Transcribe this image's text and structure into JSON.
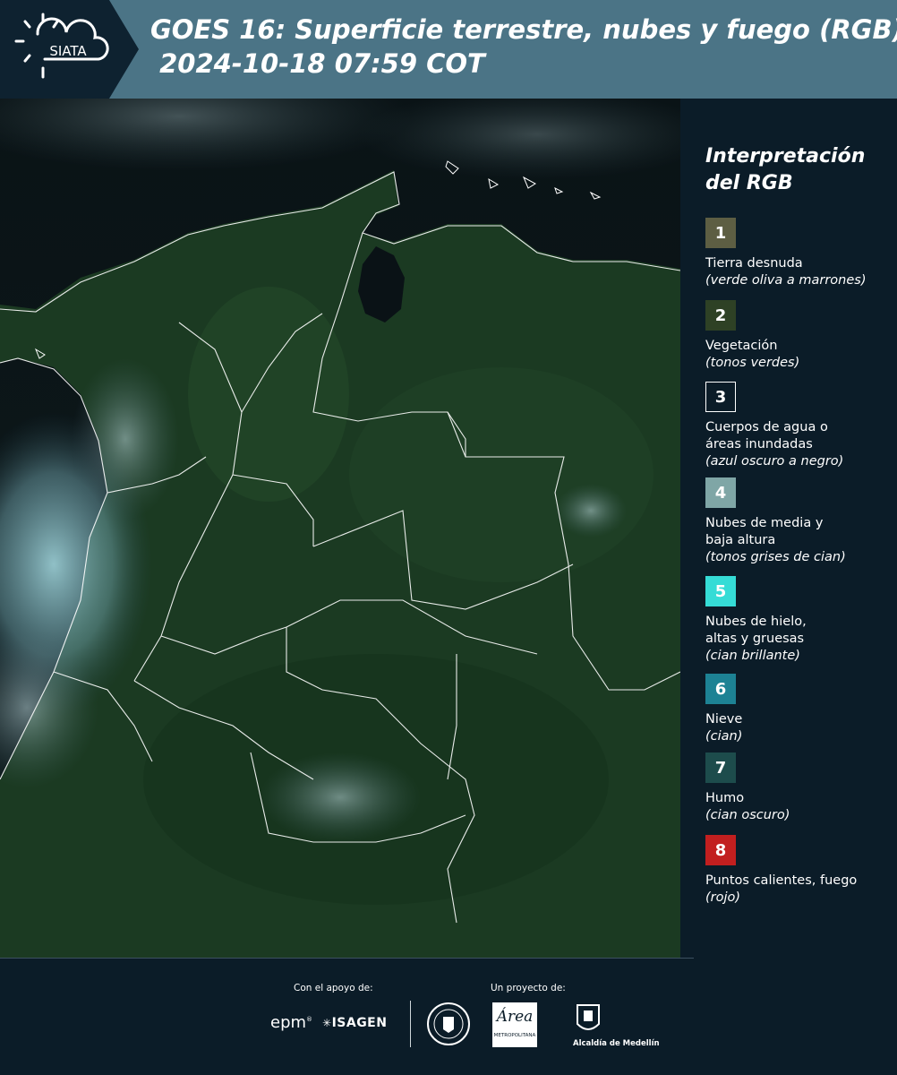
{
  "header": {
    "brand": "SIATA",
    "title_line1": "GOES 16: Superficie terrestre, nubes y fuego (RGB)",
    "title_line2": " 2024-10-18 07:59 COT"
  },
  "map": {
    "icon": "satellite-map",
    "colors": {
      "vegetation": "#1c3a22",
      "ocean": "#070d10",
      "cloud": "#8fc7d0",
      "border": "#ffffff"
    }
  },
  "legend": {
    "title": "Interpretación\ndel RGB",
    "items": [
      {
        "num": "1",
        "label": "Tierra desnuda",
        "desc": "(verde oliva a marrones)",
        "color": "#5d5e43"
      },
      {
        "num": "2",
        "label": "Vegetación",
        "desc": "(tonos verdes)",
        "color": "#2e4125"
      },
      {
        "num": "3",
        "label": "Cuerpos de agua o\náreas inundadas",
        "desc": "(azul oscuro a negro)",
        "color": "#0b1c28"
      },
      {
        "num": "4",
        "label": "Nubes de media y\nbaja altura",
        "desc": "(tonos grises de cian)",
        "color": "#7fa6a6"
      },
      {
        "num": "5",
        "label": "Nubes de hielo,\naltas y gruesas",
        "desc": "(cian brillante)",
        "color": "#35dcd6"
      },
      {
        "num": "6",
        "label": "Nieve",
        "desc": "(cian)",
        "color": "#1d8294"
      },
      {
        "num": "7",
        "label": "Humo",
        "desc": "(cian oscuro)",
        "color": "#1d4c4c"
      },
      {
        "num": "8",
        "label": "Puntos calientes, fuego",
        "desc": "(rojo)",
        "color": "#c21f1f"
      }
    ]
  },
  "footer": {
    "support_label": "Con el apoyo de:",
    "project_label": "Un proyecto de:",
    "epm": "epm",
    "isagen": "ISAGEN",
    "area_main": "Área",
    "area_sub": "METROPOLITANA",
    "alcaldia": "Alcaldía de Medellín"
  }
}
